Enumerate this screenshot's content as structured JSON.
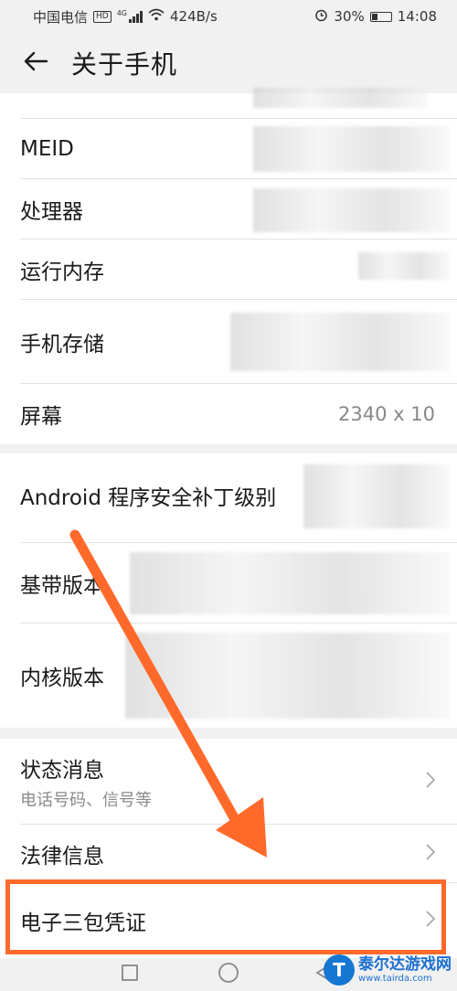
{
  "status_bar": {
    "carrier": "中国电信",
    "network_badge": "HD",
    "network_type": "4G",
    "speed": "424B/s",
    "battery": "30%",
    "time": "14:08",
    "icons": [
      "signal-icon",
      "wifi-icon",
      "alarm-icon",
      "battery-icon"
    ]
  },
  "header": {
    "title": "关于手机",
    "back_icon": "back-arrow-icon"
  },
  "group1": {
    "rows": [
      {
        "label": "MEID",
        "value": ""
      },
      {
        "label": "处理器",
        "value": ""
      },
      {
        "label": "运行内存",
        "value": ""
      },
      {
        "label": "手机存储",
        "value": ""
      },
      {
        "label": "屏幕",
        "value": "2340 x 10"
      }
    ]
  },
  "group2": {
    "rows": [
      {
        "label": "Android 程序安全补丁级别"
      },
      {
        "label": "基带版本"
      },
      {
        "label": "内核版本"
      }
    ]
  },
  "group3": {
    "rows": [
      {
        "label": "状态消息",
        "sublabel": "电话号码、信号等"
      },
      {
        "label": "法律信息"
      },
      {
        "label": "电子三包凭证"
      }
    ]
  },
  "annotation": {
    "arrow_color": "#ff6a2b",
    "highlight_color": "#ff6a2b"
  },
  "watermark": {
    "name": "泰尔达游戏网",
    "url": "www.tairda.com",
    "logo_glyph": "T"
  }
}
